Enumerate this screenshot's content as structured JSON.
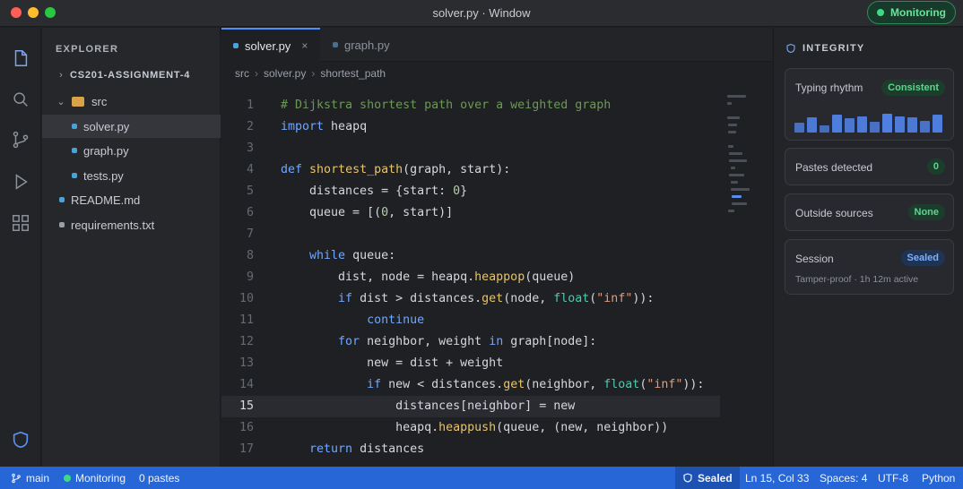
{
  "window": {
    "title": "solver.py · Window",
    "monitor_label": "Monitoring"
  },
  "activity_bar": [
    "files-icon",
    "search-icon",
    "source-control-icon",
    "run-icon",
    "extensions-icon",
    "shield-icon"
  ],
  "explorer": {
    "title": "EXPLORER",
    "project": "CS201-ASSIGNMENT-4",
    "folder": "src",
    "files": [
      {
        "name": "solver.py",
        "color": "#4aa3d8"
      },
      {
        "name": "graph.py",
        "color": "#4aa3d8"
      },
      {
        "name": "tests.py",
        "color": "#4aa3d8"
      },
      {
        "name": "README.md",
        "color": "#4aa3d8"
      },
      {
        "name": "requirements.txt",
        "color": "#9aa0a8"
      }
    ]
  },
  "tabs": [
    {
      "label": "solver.py",
      "close": "×"
    },
    {
      "label": "graph.py"
    }
  ],
  "breadcrumb": [
    "src",
    "solver.py",
    "shortest_path"
  ],
  "editor": {
    "current_line": 15,
    "lines": [
      {
        "n": "1",
        "parts": [
          [
            "cm",
            "# Dijkstra shortest path over a weighted graph"
          ]
        ]
      },
      {
        "n": "2",
        "parts": [
          [
            "kw",
            "import"
          ],
          [
            "",
            " heapq"
          ]
        ]
      },
      {
        "n": "3",
        "parts": []
      },
      {
        "n": "4",
        "parts": [
          [
            "kw",
            "def"
          ],
          [
            "",
            " "
          ],
          [
            "fn",
            "shortest_path"
          ],
          [
            "",
            "(graph, start):"
          ]
        ]
      },
      {
        "n": "5",
        "parts": [
          [
            "",
            "    distances = {start: "
          ],
          [
            "num",
            "0"
          ],
          [
            "",
            "}"
          ]
        ]
      },
      {
        "n": "6",
        "parts": [
          [
            "",
            "    queue = [("
          ],
          [
            "num",
            "0"
          ],
          [
            "",
            ", start)]"
          ]
        ]
      },
      {
        "n": "7",
        "parts": []
      },
      {
        "n": "8",
        "parts": [
          [
            "",
            "    "
          ],
          [
            "kw",
            "while"
          ],
          [
            "",
            " queue:"
          ]
        ]
      },
      {
        "n": "9",
        "parts": [
          [
            "",
            "        dist, node = heapq."
          ],
          [
            "fn",
            "heappop"
          ],
          [
            "",
            "(queue)"
          ]
        ]
      },
      {
        "n": "10",
        "parts": [
          [
            "",
            "        "
          ],
          [
            "kw",
            "if"
          ],
          [
            "",
            " dist > distances."
          ],
          [
            "fn",
            "get"
          ],
          [
            "",
            "(node, "
          ],
          [
            "bi",
            "float"
          ],
          [
            "",
            "("
          ],
          [
            "str",
            "\"inf\""
          ],
          [
            "",
            ")):"
          ]
        ]
      },
      {
        "n": "11",
        "parts": [
          [
            "",
            "            "
          ],
          [
            "kw",
            "continue"
          ]
        ]
      },
      {
        "n": "12",
        "parts": [
          [
            "",
            "        "
          ],
          [
            "kw",
            "for"
          ],
          [
            "",
            " neighbor, weight "
          ],
          [
            "kw",
            "in"
          ],
          [
            "",
            " graph[node]:"
          ]
        ]
      },
      {
        "n": "13",
        "parts": [
          [
            "",
            "            new = dist + weight"
          ]
        ]
      },
      {
        "n": "14",
        "parts": [
          [
            "",
            "            "
          ],
          [
            "kw",
            "if"
          ],
          [
            "",
            " new < distances."
          ],
          [
            "fn",
            "get"
          ],
          [
            "",
            "(neighbor, "
          ],
          [
            "bi",
            "float"
          ],
          [
            "",
            "("
          ],
          [
            "str",
            "\"inf\""
          ],
          [
            "",
            ")):"
          ]
        ]
      },
      {
        "n": "15",
        "parts": [
          [
            "",
            "                distances[neighbor] = new"
          ]
        ]
      },
      {
        "n": "16",
        "parts": [
          [
            "",
            "                heapq."
          ],
          [
            "fn",
            "heappush"
          ],
          [
            "",
            "(queue, (new, neighbor))"
          ]
        ]
      },
      {
        "n": "17",
        "parts": [
          [
            "",
            "    "
          ],
          [
            "kw",
            "return"
          ],
          [
            "",
            " distances"
          ]
        ]
      }
    ]
  },
  "integrity": {
    "title": "INTEGRITY",
    "typing": {
      "label": "Typing rhythm",
      "status": "Consistent",
      "levels": [
        0.5,
        0.8,
        0.4,
        0.95,
        0.75,
        0.85,
        0.55,
        1.0,
        0.85,
        0.8,
        0.6,
        0.95
      ]
    },
    "pastes": {
      "label": "Pastes detected",
      "value": "0"
    },
    "sources": {
      "label": "Outside sources",
      "value": "None"
    },
    "session": {
      "label": "Session",
      "status": "Sealed",
      "detail": "Tamper-proof · 1h 12m active"
    }
  },
  "status_bar": {
    "branch": "main",
    "monitoring": "Monitoring",
    "pastes": "0 pastes",
    "sealed": "Sealed",
    "position": "Ln 15, Col 33",
    "spaces": "Spaces: 4",
    "encoding": "UTF-8",
    "language": "Python"
  },
  "colors": {
    "accent": "#2766d6",
    "ok": "#3ddc84",
    "folder": "#d7a24a"
  }
}
